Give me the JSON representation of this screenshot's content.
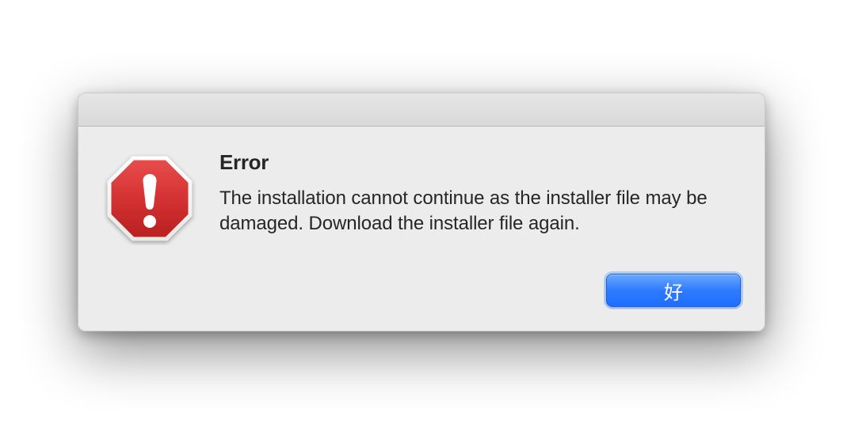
{
  "dialog": {
    "title": "Error",
    "message": "The installation cannot continue as the installer file may be damaged. Download the installer file again.",
    "ok_label": "好"
  }
}
